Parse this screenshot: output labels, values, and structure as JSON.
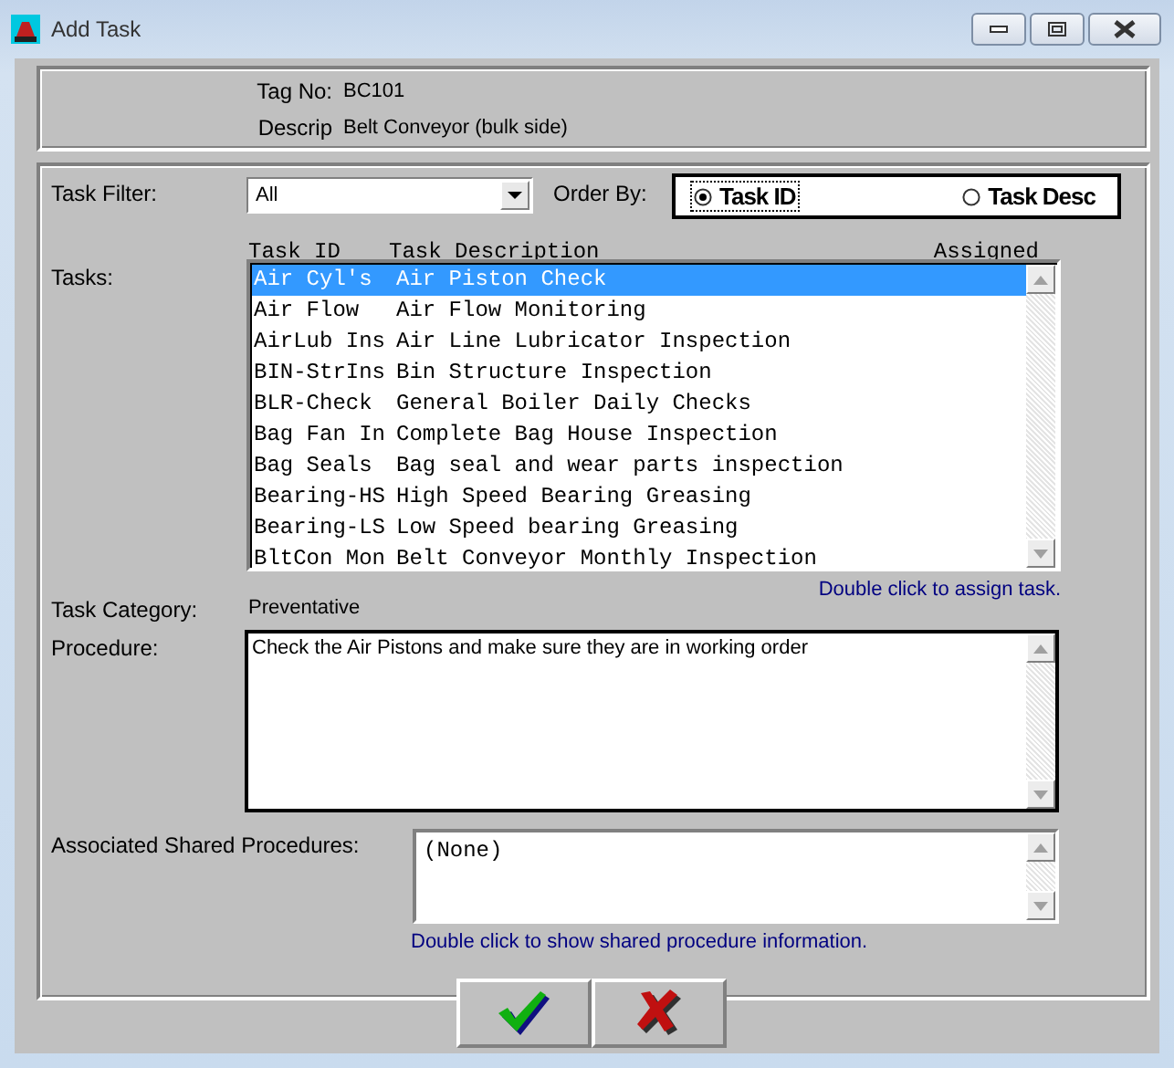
{
  "window": {
    "title": "Add Task"
  },
  "header": {
    "tag_label": "Tag No:",
    "tag_value": "BC101",
    "descrip_label": "Descrip",
    "descrip_value": "Belt Conveyor (bulk side)"
  },
  "task_filter": {
    "label": "Task Filter:",
    "value": "All"
  },
  "order_by": {
    "label": "Order By:",
    "options": [
      {
        "label": "Task ID",
        "selected": true
      },
      {
        "label": "Task Desc",
        "selected": false
      }
    ]
  },
  "tasks": {
    "label": "Tasks:",
    "columns": [
      "Task ID",
      "Task Description",
      "Assigned"
    ],
    "rows": [
      {
        "task_id": "Air Cyl's",
        "description": "Air Piston Check",
        "selected": true
      },
      {
        "task_id": "Air Flow",
        "description": "Air Flow Monitoring",
        "selected": false
      },
      {
        "task_id": "AirLub Ins",
        "description": "Air Line Lubricator Inspection",
        "selected": false
      },
      {
        "task_id": "BIN-StrIns",
        "description": "Bin Structure Inspection",
        "selected": false
      },
      {
        "task_id": "BLR-Check",
        "description": "General Boiler Daily Checks",
        "selected": false
      },
      {
        "task_id": "Bag Fan In",
        "description": "Complete Bag House Inspection",
        "selected": false
      },
      {
        "task_id": "Bag Seals",
        "description": "Bag seal and wear parts inspection",
        "selected": false
      },
      {
        "task_id": "Bearing-HS",
        "description": "High Speed Bearing Greasing",
        "selected": false
      },
      {
        "task_id": "Bearing-LS",
        "description": "Low Speed bearing Greasing",
        "selected": false
      },
      {
        "task_id": "BltCon Mon",
        "description": "Belt Conveyor Monthly Inspection",
        "selected": false
      }
    ],
    "hint": "Double click to assign task."
  },
  "task_category": {
    "label": "Task Category:",
    "value": "Preventative"
  },
  "procedure": {
    "label": "Procedure:",
    "value": "Check the Air Pistons and make sure they are in working order"
  },
  "shared_procedures": {
    "label": "Associated Shared Procedures:",
    "value": "(None)",
    "hint": "Double click to show shared procedure information."
  },
  "buttons": [
    {
      "kind": "ok"
    },
    {
      "kind": "cancel"
    }
  ]
}
